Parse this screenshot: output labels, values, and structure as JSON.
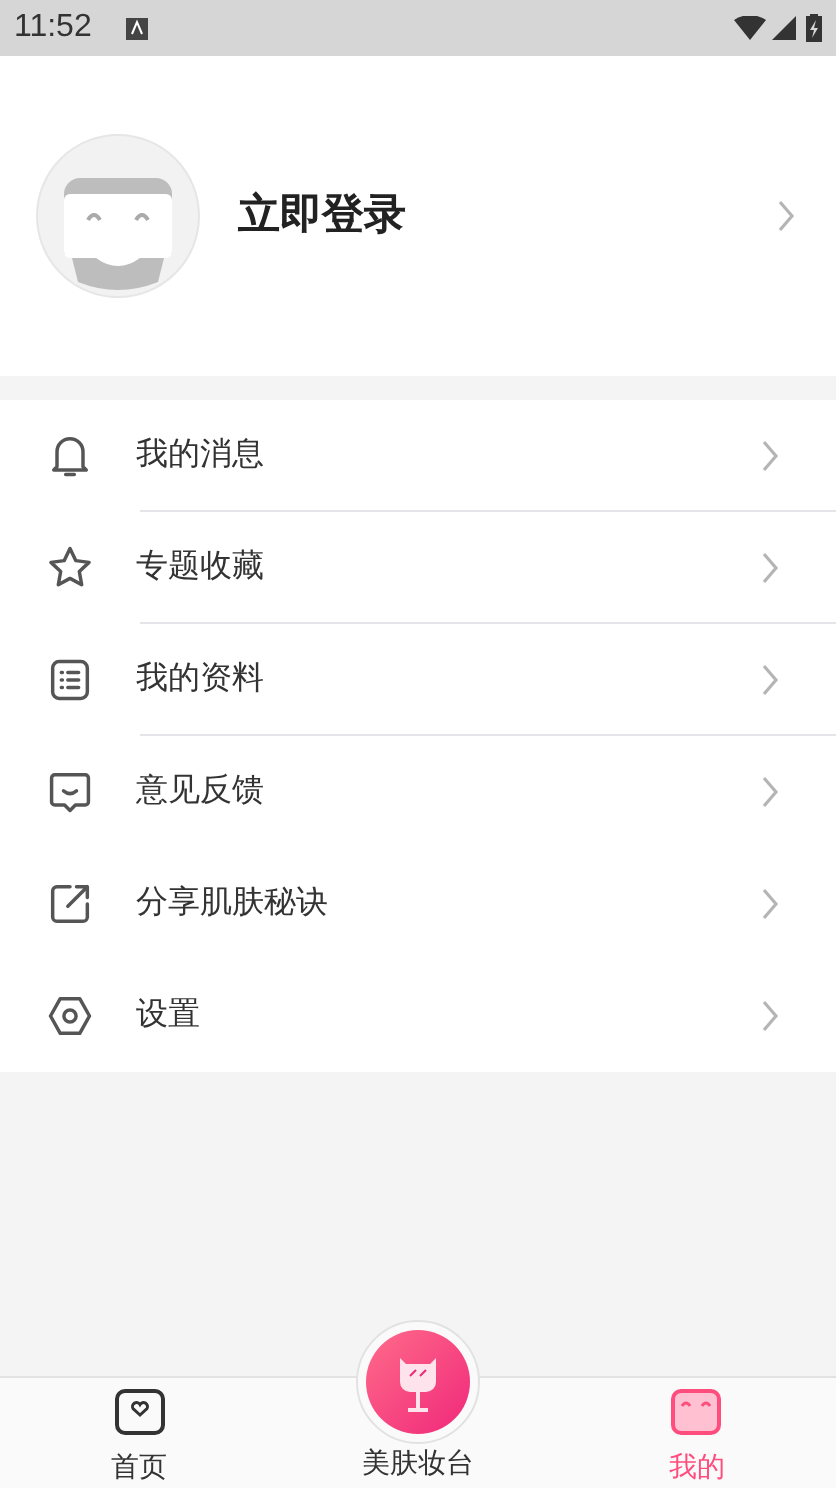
{
  "status_bar": {
    "time": "11:52"
  },
  "profile": {
    "login_label": "立即登录"
  },
  "menu": [
    {
      "label": "我的消息",
      "kind": "bell",
      "divider": true
    },
    {
      "label": "专题收藏",
      "kind": "star",
      "divider": true
    },
    {
      "label": "我的资料",
      "kind": "list",
      "divider": true
    },
    {
      "label": "意见反馈",
      "kind": "chat",
      "divider": false
    },
    {
      "label": "分享肌肤秘诀",
      "kind": "share",
      "divider": false
    },
    {
      "label": "设置",
      "kind": "settings",
      "divider": false
    }
  ],
  "tabs": [
    {
      "label": "首页",
      "kind": "home",
      "selected": false
    },
    {
      "label": "美肤妆台",
      "kind": "center",
      "selected": false
    },
    {
      "label": "我的",
      "kind": "mine",
      "selected": true
    }
  ]
}
